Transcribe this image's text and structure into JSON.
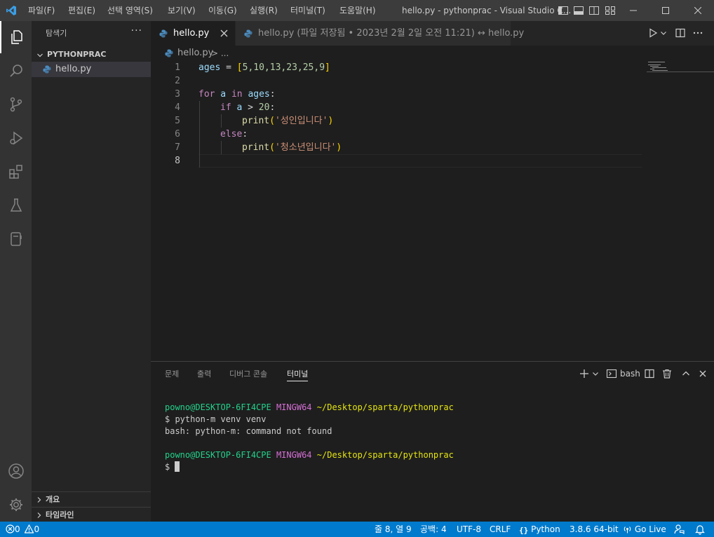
{
  "titlebar": {
    "menus": [
      "파일(F)",
      "편집(E)",
      "선택 영역(S)",
      "보기(V)",
      "이동(G)",
      "실행(R)",
      "터미널(T)",
      "도움말(H)"
    ],
    "window_title": "hello.py - pythonprac - Visual Studio C...",
    "icons": [
      "vscode-logo-icon",
      "toggle-sidebar-icon",
      "toggle-panel-icon",
      "layout-icon",
      "customize-layout-icon"
    ],
    "window_buttons": [
      "minimize-icon",
      "maximize-icon",
      "close-icon"
    ]
  },
  "activitybar": {
    "items": [
      "explorer-icon",
      "search-icon",
      "source-control-icon",
      "run-debug-icon",
      "extensions-icon",
      "testing-icon",
      "notebook-icon"
    ],
    "bottom": [
      "account-icon",
      "settings-gear-icon"
    ]
  },
  "sidebar": {
    "title": "탐색기",
    "more": "···",
    "folder": "PYTHONPRAC",
    "files": [
      {
        "name": "hello.py"
      }
    ],
    "sections": [
      "개요",
      "타임라인"
    ]
  },
  "tabs": [
    {
      "label": "hello.py",
      "active": true
    },
    {
      "label": "hello.py (파일 저장됨 • 2023년 2월 2일 오전 11:21) ↔ hello.py",
      "active": false
    }
  ],
  "breadcrumb": {
    "file": "hello.py",
    "sep": "> ..."
  },
  "editor": {
    "lines": [
      1,
      2,
      3,
      4,
      5,
      6,
      7,
      8
    ],
    "current_line": 8,
    "code": {
      "l1_var": "ages",
      "l1_eq": " = ",
      "l1_open": "[",
      "l1_vals": "5,10,13,23,25,9",
      "l1_close": "]",
      "l3_for": "for",
      "l3_a": " a ",
      "l3_in": "in",
      "l3_ages": " ages",
      "l3_colon": ":",
      "l4_if": "if",
      "l4_a": " a ",
      "l4_gt": "> ",
      "l4_num": "20",
      "l4_colon": ":",
      "l5_print": "print",
      "l5_open": "(",
      "l5_str": "'성인입니다'",
      "l5_close": ")",
      "l6_else": "else",
      "l6_colon": ":",
      "l7_print": "print",
      "l7_open": "(",
      "l7_str": "'청소년입니다'",
      "l7_close": ")"
    }
  },
  "panel": {
    "tabs": [
      "문제",
      "출력",
      "디버그 콘솔",
      "터미널"
    ],
    "active_tab": "터미널",
    "shell": "bash",
    "terminal": [
      {
        "user": "powno@DESKTOP-6FI4CPE",
        "sys": "MINGW64",
        "path": "~/Desktop/sparta/pythonprac"
      },
      {
        "text": "$ python-m venv venv"
      },
      {
        "text": "bash: python-m: command not found"
      },
      {
        "text": ""
      },
      {
        "user": "powno@DESKTOP-6FI4CPE",
        "sys": "MINGW64",
        "path": "~/Desktop/sparta/pythonprac"
      },
      {
        "text": "$ "
      }
    ]
  },
  "statusbar": {
    "errors": "0",
    "warnings": "0",
    "position": "줄 8, 열 9",
    "spaces": "공백: 4",
    "encoding": "UTF-8",
    "eol": "CRLF",
    "language": "Python",
    "interpreter": "3.8.6 64-bit",
    "golive": "Go Live"
  },
  "colors": {
    "titlebar": "#3c3c3c",
    "activitybar": "#333333",
    "sidebar": "#252526",
    "editor": "#1e1e1e",
    "statusbar": "#007acc",
    "keyword": "#c586c0",
    "variable": "#9cdcfe",
    "number": "#b5cea8",
    "string": "#ce9178",
    "function": "#dcdcaa"
  }
}
